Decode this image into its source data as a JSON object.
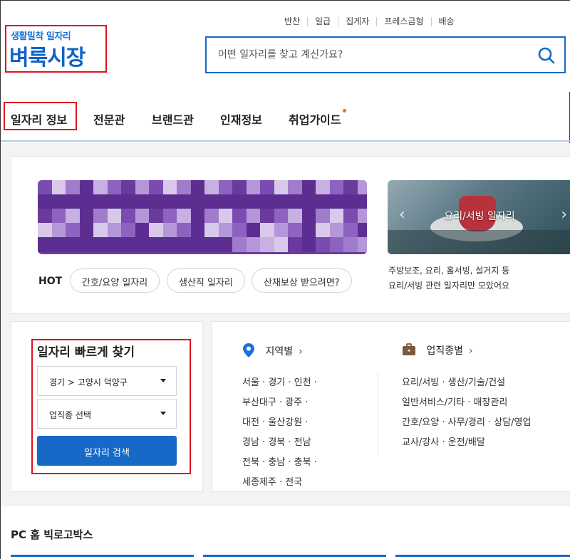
{
  "header": {
    "logo_sub": "생활밀착 일자리",
    "logo_main": "벼룩시장",
    "top_links": [
      "반찬",
      "일급",
      "집게자",
      "프레스금형",
      "배송"
    ],
    "search_placeholder": "어떤 일자리를 찾고 계신가요?"
  },
  "gnb": {
    "items": [
      "일자리 정보",
      "전문관",
      "브랜드관",
      "인재정보",
      "취업가이드"
    ]
  },
  "hot": {
    "label": "HOT",
    "chips": [
      "간호/요양 일자리",
      "생산직 일자리",
      "산재보상 받으려면?"
    ]
  },
  "promo": {
    "caption": "요리/서빙 일자리",
    "desc_line1": "주방보조, 요리, 홀서빙, 설거지 등",
    "desc_line2": "요리/서빙 관련 일자리만 모았어요"
  },
  "quick": {
    "title": "일자리 빠르게 찾기",
    "region_value": "경기 > 고양시 덕양구",
    "job_value": "업직종 선택",
    "button": "일자리 검색"
  },
  "regions": {
    "title": "지역별",
    "lines": [
      "서울 · 경기 · 인천 ·",
      "부산대구 · 광주 ·",
      "대전 · 울산강원 ·",
      "경남 · 경북 · 전남",
      "전북 · 충남 · 충북 ·",
      "세종제주 · 전국"
    ]
  },
  "jobs": {
    "title": "업직종별",
    "lines": [
      "요리/서빙 · 생산/기술/건설",
      "일반서비스/기타 · 매장관리",
      "간호/요양 · 사무/경리 · 상담/영업",
      "교사/강사 · 운전/배달"
    ]
  },
  "bottom": {
    "title": "PC 홈 빅로고박스"
  },
  "colors": {
    "brand_blue": "#1162c8",
    "button_blue": "#1769c7",
    "highlight_red": "#e0121f",
    "banner_purple": "#6d3aa3"
  }
}
